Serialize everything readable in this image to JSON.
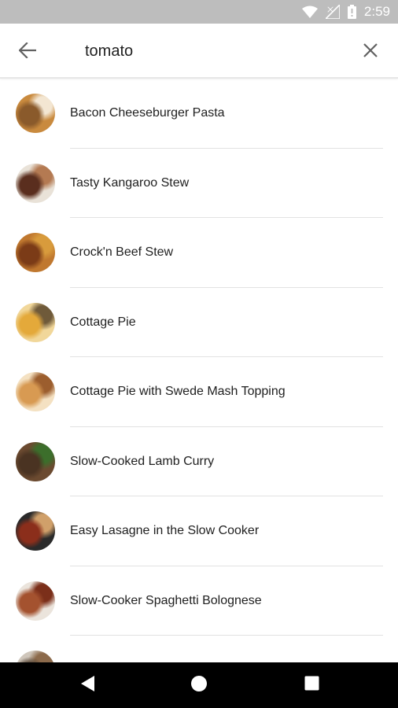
{
  "status_bar": {
    "time": "2:59",
    "icons": [
      "wifi-icon",
      "signal-icon",
      "battery-icon"
    ]
  },
  "search": {
    "query": "tomato",
    "back_icon": "arrow-back-icon",
    "clear_icon": "close-icon"
  },
  "results": [
    {
      "title": "Bacon Cheeseburger Pasta",
      "colors": [
        "#8a5a2b",
        "#c98a3e",
        "#f3e6d2"
      ]
    },
    {
      "title": "Tasty Kangaroo Stew",
      "colors": [
        "#5a2e1e",
        "#e9e2d8",
        "#b47a52"
      ]
    },
    {
      "title": "Crock'n Beef Stew",
      "colors": [
        "#7b3b17",
        "#c0782f",
        "#d89b3c"
      ]
    },
    {
      "title": "Cottage Pie",
      "colors": [
        "#e4a93a",
        "#f1d79a",
        "#6f5a3a"
      ]
    },
    {
      "title": "Cottage Pie with Swede Mash Topping",
      "colors": [
        "#d89a52",
        "#f4e1c2",
        "#9c5e2e"
      ]
    },
    {
      "title": "Slow-Cooked Lamb Curry",
      "colors": [
        "#4a3322",
        "#6b4a30",
        "#3c6e2b"
      ]
    },
    {
      "title": "Easy Lasagne in the Slow Cooker",
      "colors": [
        "#8b2e1b",
        "#2a2a2a",
        "#d0a06a"
      ]
    },
    {
      "title": "Slow-Cooker Spaghetti Bolognese",
      "colors": [
        "#a4522f",
        "#ebe4dc",
        "#7b2f1a"
      ]
    },
    {
      "title": "",
      "colors": [
        "#5b4a3a",
        "#cfc6bb",
        "#8c6a4b"
      ]
    }
  ],
  "nav_bar": {
    "back_icon": "nav-back-icon",
    "home_icon": "nav-home-icon",
    "recents_icon": "nav-recents-icon"
  }
}
